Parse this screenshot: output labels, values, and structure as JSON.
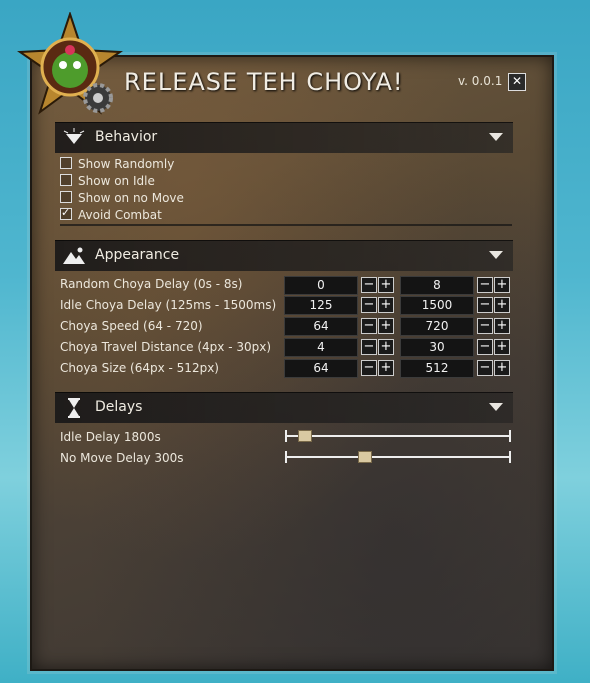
{
  "window": {
    "title": "RELEASE TEH CHOYA!",
    "version": "v. 0.0.1",
    "close_label": "✕"
  },
  "colors": {
    "accent": "#e9e6e0",
    "panel": "#5a4a35",
    "header": "#1e1e1f"
  },
  "behavior": {
    "header": "Behavior",
    "options": [
      {
        "label": "Show Randomly",
        "checked": false
      },
      {
        "label": "Show on Idle",
        "checked": false
      },
      {
        "label": "Show on no Move",
        "checked": false
      },
      {
        "label": "Avoid Combat",
        "checked": true
      }
    ]
  },
  "appearance": {
    "header": "Appearance",
    "rows": [
      {
        "label": "Random Choya Delay (0s - 8s)",
        "min": "0",
        "max": "8"
      },
      {
        "label": "Idle Choya Delay (125ms - 1500ms)",
        "min": "125",
        "max": "1500"
      },
      {
        "label": "Choya Speed (64 - 720)",
        "min": "64",
        "max": "720"
      },
      {
        "label": "Choya Travel Distance (4px - 30px)",
        "min": "4",
        "max": "30"
      },
      {
        "label": "Choya Size (64px - 512px)",
        "min": "64",
        "max": "512"
      }
    ],
    "minus": "−",
    "plus": "+"
  },
  "delays": {
    "header": "Delays",
    "sliders": [
      {
        "label": "Idle Delay 1800s",
        "fraction": 0.08
      },
      {
        "label": "No Move Delay 300s",
        "fraction": 0.35
      }
    ]
  },
  "icons": {
    "emblem": "choya-emblem-icon",
    "behavior": "diamond-icon",
    "appearance": "mountain-icon",
    "delays": "hourglass-icon",
    "collapse": "chevron-down-icon"
  }
}
